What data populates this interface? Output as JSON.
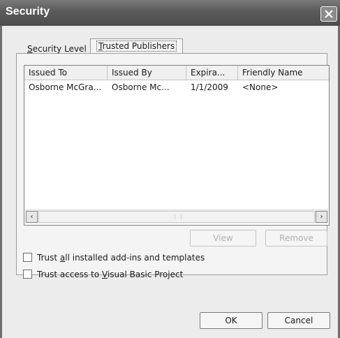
{
  "window": {
    "title": "Security",
    "close_icon": "close-icon"
  },
  "tabs": [
    {
      "label_pre": "",
      "label_u": "S",
      "label_post": "ecurity Level",
      "active": false
    },
    {
      "label_pre": "",
      "label_u": "T",
      "label_post": "rusted Publishers",
      "active": true
    }
  ],
  "list": {
    "columns": [
      "Issued To",
      "Issued By",
      "Expira...",
      "Friendly Name"
    ],
    "rows": [
      [
        "Osborne McGra...",
        "Osborne Mc...",
        "1/1/2009",
        "<None>"
      ]
    ],
    "scroll_left_icon": "‹",
    "scroll_right_icon": "›"
  },
  "buttons": {
    "view": "View",
    "remove": "Remove",
    "ok": "OK",
    "cancel": "Cancel"
  },
  "checkboxes": [
    {
      "pre": "Trust ",
      "u": "a",
      "post": "ll installed add-ins and templates",
      "checked": false
    },
    {
      "pre": "Trust access to ",
      "u": "V",
      "post": "isual Basic Project",
      "checked": false
    }
  ],
  "colors": {
    "titlebar": "#5a5a5a",
    "dialog_bg": "#ececec",
    "disabled_text": "#b0b0b0"
  }
}
